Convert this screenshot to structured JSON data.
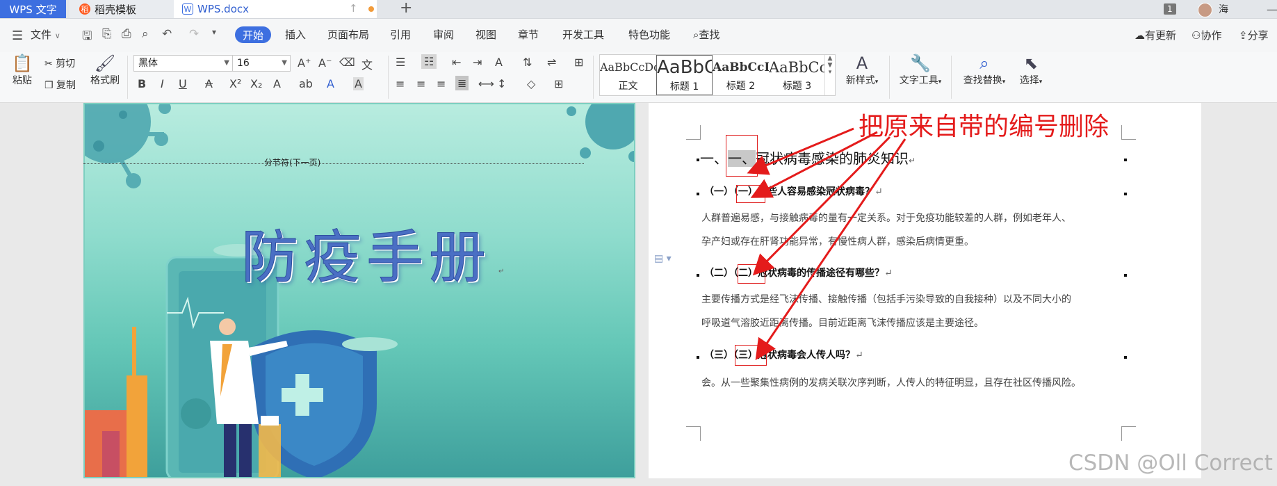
{
  "tabs": {
    "app": "WPS 文字",
    "template": "稻壳模板",
    "doc": "WPS.docx",
    "template_icon": "稻",
    "doc_icon": "W",
    "new": "+"
  },
  "titlebar_right": {
    "badge": "1",
    "user": "海",
    "minimize": "—"
  },
  "menu": {
    "file": "文件",
    "home": "开始",
    "items": [
      "插入",
      "页面布局",
      "引用",
      "审阅",
      "视图",
      "章节",
      "开发工具",
      "特色功能"
    ],
    "search": "查找",
    "right": [
      "有更新",
      "协作",
      "分享"
    ]
  },
  "ribbon": {
    "paste": "粘贴",
    "cut": "剪切",
    "copy": "复制",
    "format_painter": "格式刷",
    "font_name": "黑体",
    "font_size": "16",
    "styles": [
      {
        "preview": "AaBbCcDd",
        "name": "正文"
      },
      {
        "preview": "AaBbC",
        "name": "标题 1"
      },
      {
        "preview": "AaBbCcDd",
        "name": "标题 2"
      },
      {
        "preview": "AaBbCc",
        "name": "标题 3"
      }
    ],
    "new_style": "新样式",
    "text_tools": "文字工具",
    "find_replace": "查找替换",
    "select": "选择"
  },
  "cover": {
    "section_break": "分节符(下一页)",
    "title": "防疫手册"
  },
  "document": {
    "h1_prefix": "一、",
    "h1_auto": "一、",
    "h1_text": "冠状病毒感染的肺炎知识",
    "sections": [
      {
        "prefix": "（一）",
        "auto": "（一）",
        "title": "哪些人容易感染冠状病毒？",
        "body": [
          "人群普遍易感，与接触病毒的量有一定关系。对于免疫功能较差的人群，例如老年人、",
          "孕产妇或存在肝肾功能异常，有慢性病人群，感染后病情更重。"
        ]
      },
      {
        "prefix": "（二）",
        "auto": "（二）",
        "title": "冠状病毒的传播途径有哪些？",
        "body": [
          "主要传播方式是经飞沫传播、接触传播（包括手污染导致的自我接种）以及不同大小的",
          "呼吸道气溶胶近距离传播。目前近距离飞沫传播应该是主要途径。"
        ]
      },
      {
        "prefix": "（三）",
        "auto": "（三）",
        "title": "冠状病毒会人传人吗？",
        "body": [
          "会。从一些聚集性病例的发病关联次序判断，人传人的特征明显，且存在社区传播风险。"
        ]
      }
    ]
  },
  "annotation": "把原来自带的编号删除",
  "watermark": "CSDN @Oll Correct",
  "colors": {
    "accent": "#3d6fe0",
    "annotation_red": "#e41b1b"
  }
}
